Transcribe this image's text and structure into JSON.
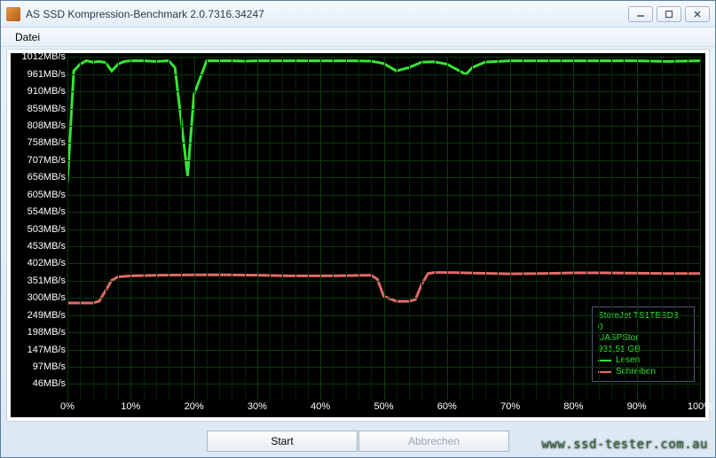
{
  "window": {
    "title": "AS SSD Kompression-Benchmark 2.0.7316.34247",
    "icon_label": "AS"
  },
  "menu": {
    "datei": "Datei"
  },
  "buttons": {
    "start": "Start",
    "abort": "Abbrechen"
  },
  "legend": {
    "device": "StoreJet TS1TESD3",
    "device_line2": "0",
    "driver": "UASPStor",
    "capacity": "931,51 GB",
    "read": "Lesen",
    "write": "Schreiben"
  },
  "colors": {
    "read": "#34e634",
    "write": "#e06a6a"
  },
  "watermark": "www.ssd-tester.com.au",
  "chart_data": {
    "type": "line",
    "xlabel": "",
    "ylabel": "MB/s",
    "xlim": [
      0,
      100
    ],
    "ylim": [
      0,
      1012
    ],
    "x_ticks": [
      0,
      10,
      20,
      30,
      40,
      50,
      60,
      70,
      80,
      90,
      100
    ],
    "x_tick_labels": [
      "0%",
      "10%",
      "20%",
      "30%",
      "40%",
      "50%",
      "60%",
      "70%",
      "80%",
      "90%",
      "100%"
    ],
    "y_ticks": [
      46,
      97,
      147,
      198,
      249,
      300,
      351,
      402,
      453,
      503,
      554,
      605,
      656,
      707,
      758,
      808,
      859,
      910,
      961,
      1012
    ],
    "y_tick_labels": [
      "46MB/s",
      "97MB/s",
      "147MB/s",
      "198MB/s",
      "249MB/s",
      "300MB/s",
      "351MB/s",
      "402MB/s",
      "453MB/s",
      "503MB/s",
      "554MB/s",
      "605MB/s",
      "656MB/s",
      "707MB/s",
      "758MB/s",
      "808MB/s",
      "859MB/s",
      "910MB/s",
      "961MB/s",
      "1012MB/s"
    ],
    "series": [
      {
        "name": "Lesen",
        "color": "#34e634",
        "x": [
          0,
          1,
          2,
          3,
          4,
          5,
          6,
          7,
          8,
          9,
          10,
          12,
          14,
          16,
          17,
          18,
          19,
          20,
          22,
          24,
          26,
          28,
          30,
          35,
          40,
          45,
          48,
          50,
          52,
          54,
          56,
          58,
          60,
          62,
          63,
          64,
          66,
          68,
          70,
          75,
          80,
          85,
          90,
          95,
          100
        ],
        "values": [
          640,
          970,
          990,
          1000,
          996,
          998,
          995,
          970,
          990,
          998,
          1000,
          1000,
          998,
          1000,
          980,
          820,
          660,
          900,
          1000,
          1000,
          1000,
          999,
          1000,
          1000,
          1000,
          1000,
          999,
          992,
          970,
          980,
          996,
          997,
          990,
          970,
          960,
          980,
          996,
          998,
          1000,
          1000,
          1000,
          1000,
          1000,
          998,
          1000
        ]
      },
      {
        "name": "Schreiben",
        "color": "#e06a6a",
        "x": [
          0,
          2,
          4,
          5,
          6,
          7,
          8,
          10,
          15,
          20,
          25,
          30,
          35,
          40,
          45,
          48,
          49,
          50,
          52,
          54,
          55,
          56,
          57,
          58,
          60,
          65,
          70,
          75,
          80,
          85,
          90,
          95,
          100
        ],
        "values": [
          285,
          285,
          285,
          290,
          320,
          352,
          362,
          365,
          367,
          368,
          368,
          367,
          365,
          365,
          366,
          367,
          355,
          305,
          290,
          290,
          295,
          340,
          372,
          375,
          375,
          373,
          371,
          372,
          374,
          374,
          373,
          372,
          372
        ]
      }
    ]
  }
}
